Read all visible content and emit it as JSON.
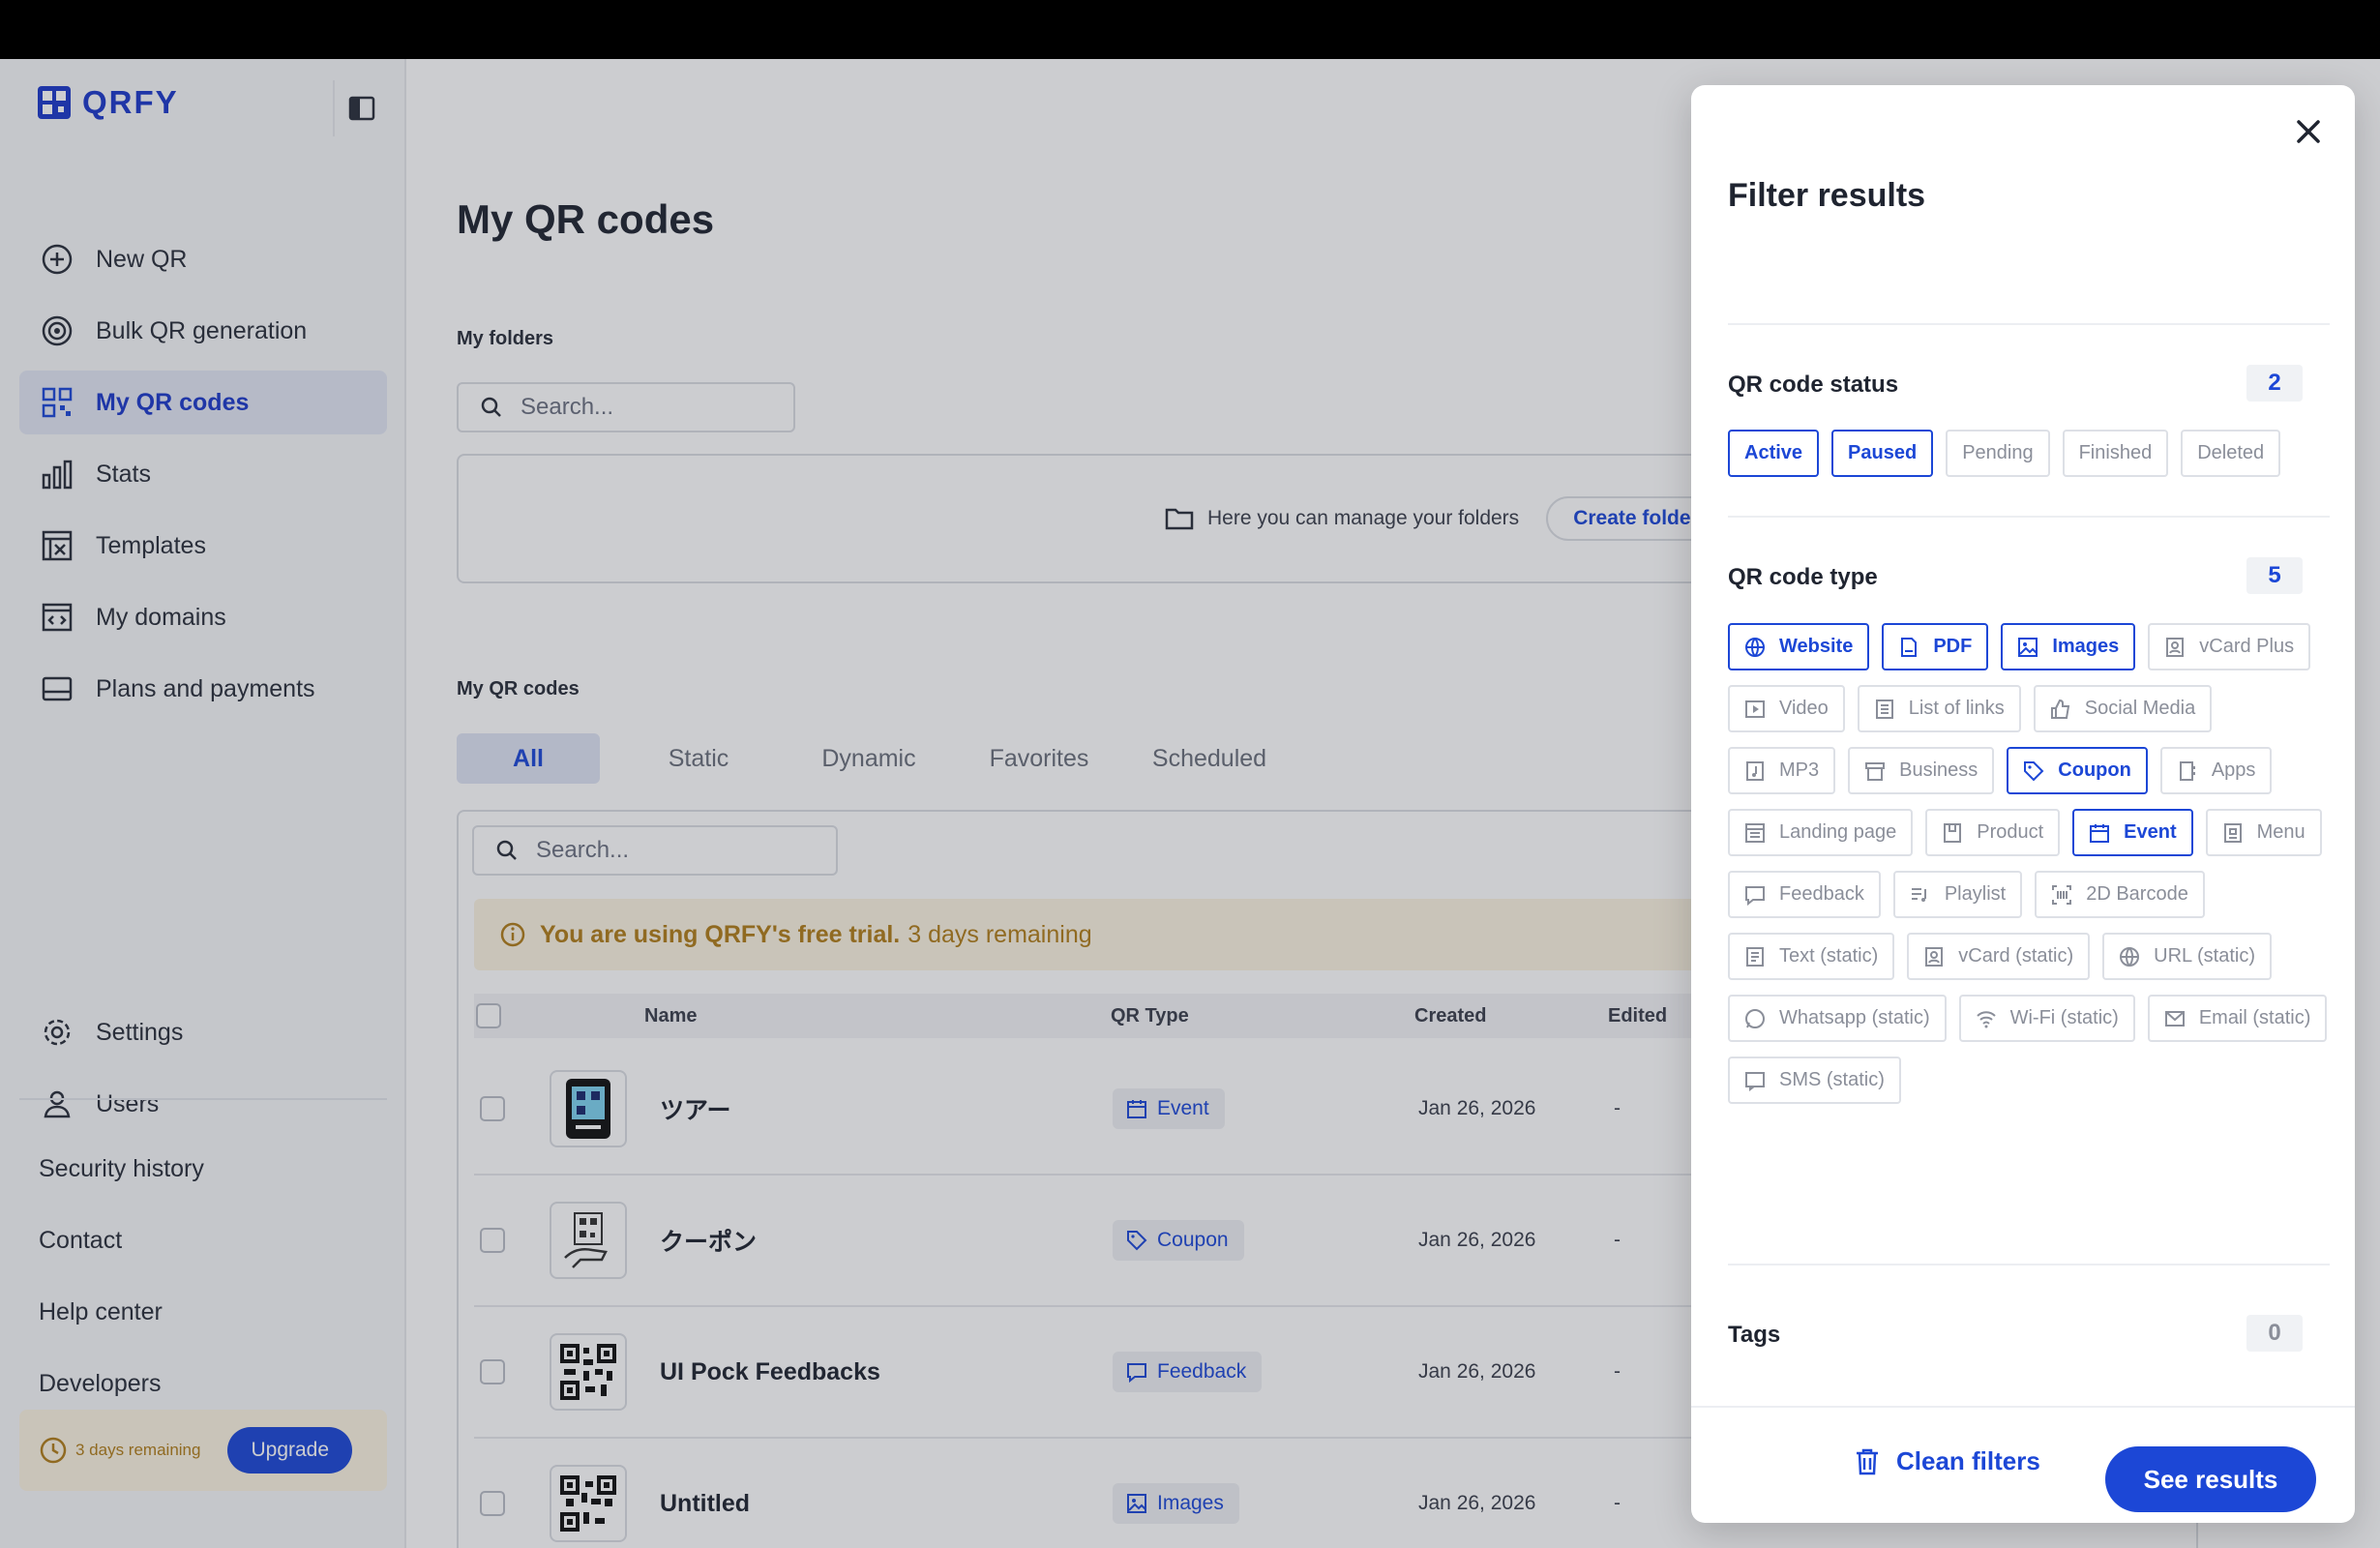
{
  "app": {
    "brand": "QRFY"
  },
  "sidebar": {
    "nav": [
      {
        "label": "New QR",
        "icon": "plus-circle-icon"
      },
      {
        "label": "Bulk QR generation",
        "icon": "target-icon"
      },
      {
        "label": "My QR codes",
        "icon": "qr-grid-icon",
        "active": true
      },
      {
        "label": "Stats",
        "icon": "bar-chart-icon"
      },
      {
        "label": "Templates",
        "icon": "template-icon"
      },
      {
        "label": "My domains",
        "icon": "domain-icon"
      },
      {
        "label": "Plans and payments",
        "icon": "card-icon"
      }
    ],
    "settings_label": "Settings",
    "users_label": "Users",
    "links": [
      "Security history",
      "Contact",
      "Help center",
      "Developers"
    ],
    "trial_text": "3 days remaining",
    "upgrade_label": "Upgrade"
  },
  "main": {
    "title": "My QR codes",
    "folders_label": "My folders",
    "folders_search_placeholder": "Search...",
    "folders_empty_text": "Here you can manage your folders",
    "create_folder_label": "Create folder",
    "codes_label": "My QR codes",
    "tabs": [
      "All",
      "Static",
      "Dynamic",
      "Favorites",
      "Scheduled"
    ],
    "codes_search_placeholder": "Search...",
    "banner_bold": "You are using QRFY's free trial.",
    "banner_rest": "3 days remaining",
    "columns": {
      "name": "Name",
      "type": "QR Type",
      "created": "Created",
      "edited": "Edited"
    },
    "rows": [
      {
        "name": "ツアー",
        "type": "Event",
        "created": "Jan 26, 2026",
        "edited": "-"
      },
      {
        "name": "クーポン",
        "type": "Coupon",
        "created": "Jan 26, 2026",
        "edited": "-"
      },
      {
        "name": "UI Pock Feedbacks",
        "type": "Feedback",
        "created": "Jan 26, 2026",
        "edited": "-"
      },
      {
        "name": "Untitled",
        "type": "Images",
        "created": "Jan 26, 2026",
        "edited": "-"
      }
    ]
  },
  "filter": {
    "title": "Filter results",
    "status_label": "QR code status",
    "status_count": "2",
    "statuses": [
      {
        "label": "Active",
        "on": true
      },
      {
        "label": "Paused",
        "on": true
      },
      {
        "label": "Pending",
        "on": false
      },
      {
        "label": "Finished",
        "on": false
      },
      {
        "label": "Deleted",
        "on": false
      }
    ],
    "type_label": "QR code type",
    "type_count": "5",
    "types": [
      {
        "label": "Website",
        "on": true,
        "icon": "globe-icon"
      },
      {
        "label": "PDF",
        "on": true,
        "icon": "pdf-icon"
      },
      {
        "label": "Images",
        "on": true,
        "icon": "image-icon"
      },
      {
        "label": "vCard Plus",
        "on": false,
        "icon": "vcard-icon"
      },
      {
        "label": "Video",
        "on": false,
        "icon": "video-icon"
      },
      {
        "label": "List of links",
        "on": false,
        "icon": "list-icon"
      },
      {
        "label": "Social Media",
        "on": false,
        "icon": "thumbs-up-icon"
      },
      {
        "label": "MP3",
        "on": false,
        "icon": "music-icon"
      },
      {
        "label": "Business",
        "on": false,
        "icon": "store-icon"
      },
      {
        "label": "Coupon",
        "on": true,
        "icon": "tag-icon"
      },
      {
        "label": "Apps",
        "on": false,
        "icon": "apps-icon"
      },
      {
        "label": "Landing page",
        "on": false,
        "icon": "page-icon"
      },
      {
        "label": "Product",
        "on": false,
        "icon": "box-icon"
      },
      {
        "label": "Event",
        "on": true,
        "icon": "calendar-icon"
      },
      {
        "label": "Menu",
        "on": false,
        "icon": "menu-icon"
      },
      {
        "label": "Feedback",
        "on": false,
        "icon": "feedback-icon"
      },
      {
        "label": "Playlist",
        "on": false,
        "icon": "playlist-icon"
      },
      {
        "label": "2D Barcode",
        "on": false,
        "icon": "barcode-icon"
      },
      {
        "label": "Text (static)",
        "on": false,
        "icon": "text-icon"
      },
      {
        "label": "vCard (static)",
        "on": false,
        "icon": "contact-icon"
      },
      {
        "label": "URL (static)",
        "on": false,
        "icon": "globe-icon"
      },
      {
        "label": "Whatsapp (static)",
        "on": false,
        "icon": "whatsapp-icon"
      },
      {
        "label": "Wi-Fi (static)",
        "on": false,
        "icon": "wifi-icon"
      },
      {
        "label": "Email (static)",
        "on": false,
        "icon": "mail-icon"
      },
      {
        "label": "SMS (static)",
        "on": false,
        "icon": "sms-icon"
      }
    ],
    "tags_label": "Tags",
    "tags_count": "0",
    "clean_label": "Clean filters",
    "see_label": "See results"
  },
  "colors": {
    "accent": "#1c47d6",
    "warning": "#b07d1a"
  }
}
